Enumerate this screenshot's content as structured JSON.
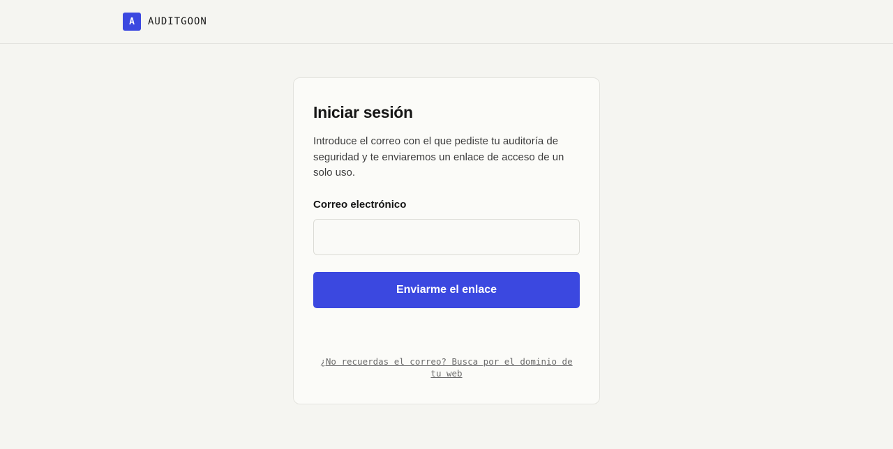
{
  "header": {
    "logo_letter": "A",
    "brand_name": "AUDITGOON"
  },
  "login": {
    "title": "Iniciar sesión",
    "description": "Introduce el correo con el que pediste tu auditoría de seguridad y te enviaremos un enlace de acceso de un solo uso.",
    "email_label": "Correo electrónico",
    "email_value": "",
    "email_placeholder": "",
    "submit_label": "Enviarme el enlace",
    "help_link": "¿No recuerdas el correo? Busca por el dominio de tu web"
  },
  "colors": {
    "accent": "#3b48e0",
    "background": "#f5f5f1",
    "card": "#fbfbf8"
  }
}
